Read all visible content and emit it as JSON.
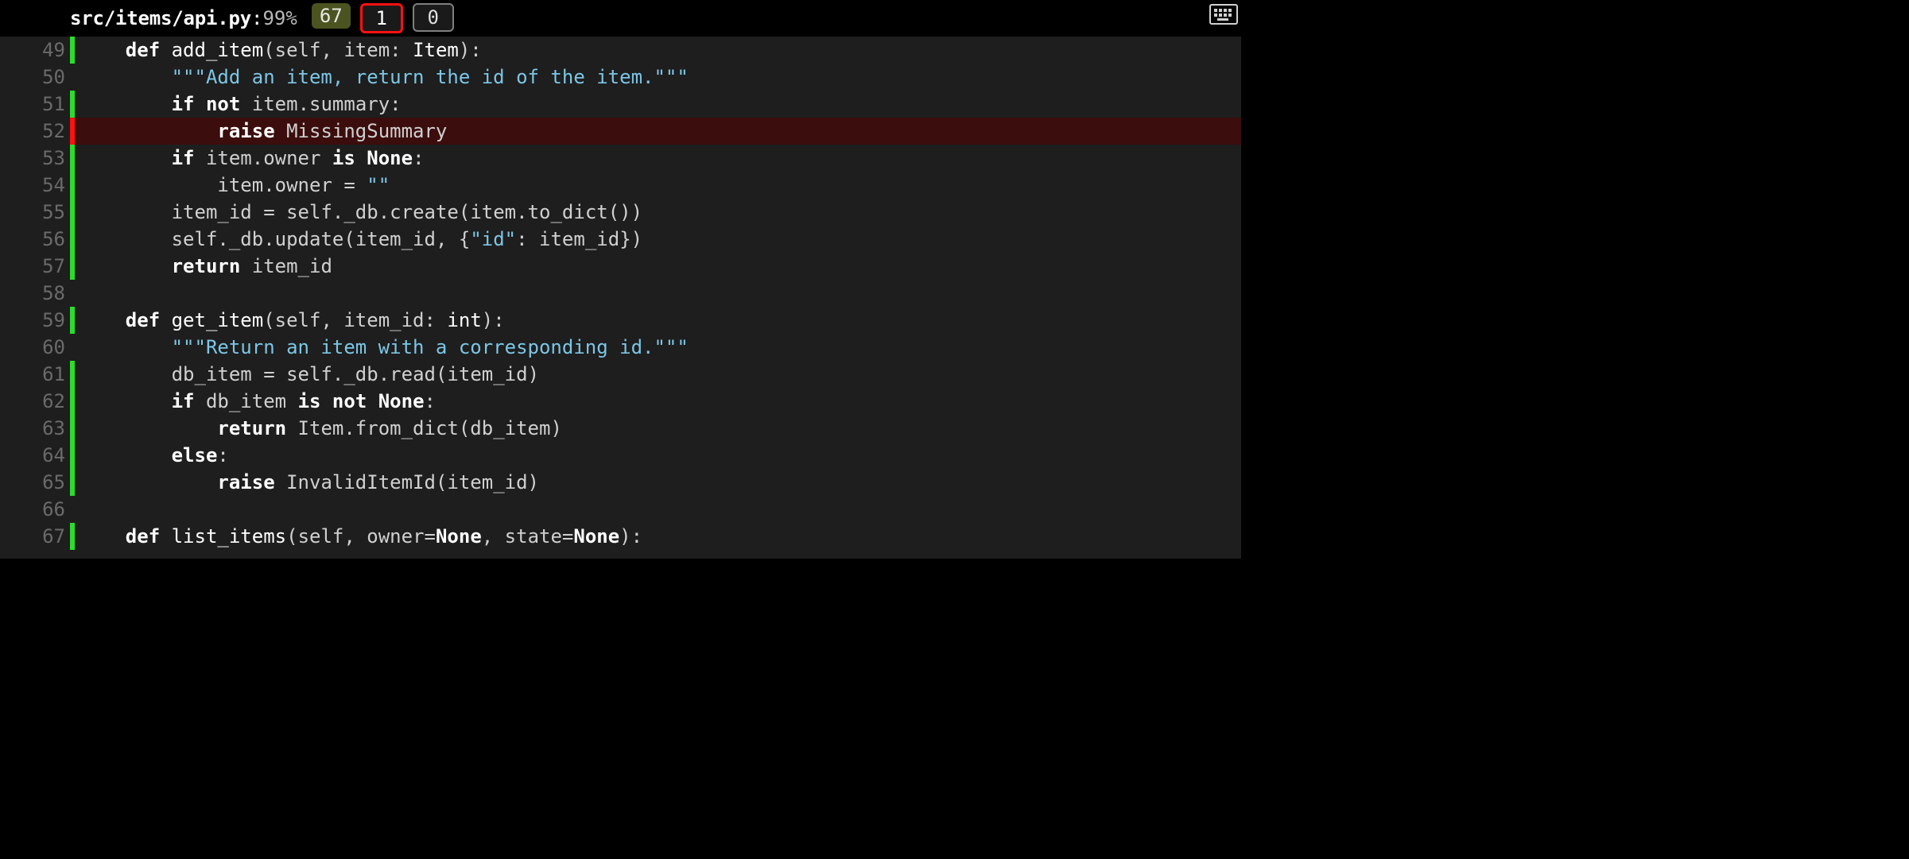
{
  "header": {
    "filepath": "src/items/api.py",
    "separator": ": ",
    "percent": "99%",
    "covered_badge": "67",
    "missing_badge": "1",
    "excluded_badge": "0"
  },
  "lines": [
    {
      "n": "49",
      "status": "run",
      "tokens": [
        {
          "t": "    ",
          "c": "id"
        },
        {
          "t": "def",
          "c": "kw"
        },
        {
          "t": " ",
          "c": "id"
        },
        {
          "t": "add_item",
          "c": "fn"
        },
        {
          "t": "(",
          "c": "op"
        },
        {
          "t": "self",
          "c": "id"
        },
        {
          "t": ", ",
          "c": "op"
        },
        {
          "t": "item",
          "c": "id"
        },
        {
          "t": ": ",
          "c": "op"
        },
        {
          "t": "Item",
          "c": "ty"
        },
        {
          "t": "):",
          "c": "op"
        }
      ]
    },
    {
      "n": "50",
      "status": "none",
      "tokens": [
        {
          "t": "        ",
          "c": "id"
        },
        {
          "t": "\"\"\"Add an item, return the id of the item.\"\"\"",
          "c": "str"
        }
      ]
    },
    {
      "n": "51",
      "status": "run",
      "tokens": [
        {
          "t": "        ",
          "c": "id"
        },
        {
          "t": "if",
          "c": "kw"
        },
        {
          "t": " ",
          "c": "id"
        },
        {
          "t": "not",
          "c": "kw"
        },
        {
          "t": " ",
          "c": "id"
        },
        {
          "t": "item",
          "c": "id"
        },
        {
          "t": ".",
          "c": "op"
        },
        {
          "t": "summary",
          "c": "id"
        },
        {
          "t": ":",
          "c": "op"
        }
      ]
    },
    {
      "n": "52",
      "status": "miss",
      "tokens": [
        {
          "t": "            ",
          "c": "id"
        },
        {
          "t": "raise",
          "c": "kw"
        },
        {
          "t": " ",
          "c": "id"
        },
        {
          "t": "MissingSummary",
          "c": "id"
        }
      ]
    },
    {
      "n": "53",
      "status": "run",
      "tokens": [
        {
          "t": "        ",
          "c": "id"
        },
        {
          "t": "if",
          "c": "kw"
        },
        {
          "t": " ",
          "c": "id"
        },
        {
          "t": "item",
          "c": "id"
        },
        {
          "t": ".",
          "c": "op"
        },
        {
          "t": "owner",
          "c": "id"
        },
        {
          "t": " ",
          "c": "id"
        },
        {
          "t": "is",
          "c": "kw"
        },
        {
          "t": " ",
          "c": "id"
        },
        {
          "t": "None",
          "c": "kw"
        },
        {
          "t": ":",
          "c": "op"
        }
      ]
    },
    {
      "n": "54",
      "status": "run",
      "tokens": [
        {
          "t": "            ",
          "c": "id"
        },
        {
          "t": "item",
          "c": "id"
        },
        {
          "t": ".",
          "c": "op"
        },
        {
          "t": "owner",
          "c": "id"
        },
        {
          "t": " = ",
          "c": "op"
        },
        {
          "t": "\"\"",
          "c": "str"
        }
      ]
    },
    {
      "n": "55",
      "status": "run",
      "tokens": [
        {
          "t": "        ",
          "c": "id"
        },
        {
          "t": "item_id",
          "c": "id"
        },
        {
          "t": " = ",
          "c": "op"
        },
        {
          "t": "self",
          "c": "id"
        },
        {
          "t": ".",
          "c": "op"
        },
        {
          "t": "_db",
          "c": "id"
        },
        {
          "t": ".",
          "c": "op"
        },
        {
          "t": "create",
          "c": "id"
        },
        {
          "t": "(",
          "c": "op"
        },
        {
          "t": "item",
          "c": "id"
        },
        {
          "t": ".",
          "c": "op"
        },
        {
          "t": "to_dict",
          "c": "id"
        },
        {
          "t": "())",
          "c": "op"
        }
      ]
    },
    {
      "n": "56",
      "status": "run",
      "tokens": [
        {
          "t": "        ",
          "c": "id"
        },
        {
          "t": "self",
          "c": "id"
        },
        {
          "t": ".",
          "c": "op"
        },
        {
          "t": "_db",
          "c": "id"
        },
        {
          "t": ".",
          "c": "op"
        },
        {
          "t": "update",
          "c": "id"
        },
        {
          "t": "(",
          "c": "op"
        },
        {
          "t": "item_id",
          "c": "id"
        },
        {
          "t": ", {",
          "c": "op"
        },
        {
          "t": "\"id\"",
          "c": "str"
        },
        {
          "t": ": ",
          "c": "op"
        },
        {
          "t": "item_id",
          "c": "id"
        },
        {
          "t": "})",
          "c": "op"
        }
      ]
    },
    {
      "n": "57",
      "status": "run",
      "tokens": [
        {
          "t": "        ",
          "c": "id"
        },
        {
          "t": "return",
          "c": "kw"
        },
        {
          "t": " ",
          "c": "id"
        },
        {
          "t": "item_id",
          "c": "id"
        }
      ]
    },
    {
      "n": "58",
      "status": "none",
      "tokens": []
    },
    {
      "n": "59",
      "status": "run",
      "tokens": [
        {
          "t": "    ",
          "c": "id"
        },
        {
          "t": "def",
          "c": "kw"
        },
        {
          "t": " ",
          "c": "id"
        },
        {
          "t": "get_item",
          "c": "fn"
        },
        {
          "t": "(",
          "c": "op"
        },
        {
          "t": "self",
          "c": "id"
        },
        {
          "t": ", ",
          "c": "op"
        },
        {
          "t": "item_id",
          "c": "id"
        },
        {
          "t": ": ",
          "c": "op"
        },
        {
          "t": "int",
          "c": "ty"
        },
        {
          "t": "):",
          "c": "op"
        }
      ]
    },
    {
      "n": "60",
      "status": "none",
      "tokens": [
        {
          "t": "        ",
          "c": "id"
        },
        {
          "t": "\"\"\"Return an item with a corresponding id.\"\"\"",
          "c": "str"
        }
      ]
    },
    {
      "n": "61",
      "status": "run",
      "tokens": [
        {
          "t": "        ",
          "c": "id"
        },
        {
          "t": "db_item",
          "c": "id"
        },
        {
          "t": " = ",
          "c": "op"
        },
        {
          "t": "self",
          "c": "id"
        },
        {
          "t": ".",
          "c": "op"
        },
        {
          "t": "_db",
          "c": "id"
        },
        {
          "t": ".",
          "c": "op"
        },
        {
          "t": "read",
          "c": "id"
        },
        {
          "t": "(",
          "c": "op"
        },
        {
          "t": "item_id",
          "c": "id"
        },
        {
          "t": ")",
          "c": "op"
        }
      ]
    },
    {
      "n": "62",
      "status": "run",
      "tokens": [
        {
          "t": "        ",
          "c": "id"
        },
        {
          "t": "if",
          "c": "kw"
        },
        {
          "t": " ",
          "c": "id"
        },
        {
          "t": "db_item",
          "c": "id"
        },
        {
          "t": " ",
          "c": "id"
        },
        {
          "t": "is",
          "c": "kw"
        },
        {
          "t": " ",
          "c": "id"
        },
        {
          "t": "not",
          "c": "kw"
        },
        {
          "t": " ",
          "c": "id"
        },
        {
          "t": "None",
          "c": "kw"
        },
        {
          "t": ":",
          "c": "op"
        }
      ]
    },
    {
      "n": "63",
      "status": "run",
      "tokens": [
        {
          "t": "            ",
          "c": "id"
        },
        {
          "t": "return",
          "c": "kw"
        },
        {
          "t": " ",
          "c": "id"
        },
        {
          "t": "Item",
          "c": "id"
        },
        {
          "t": ".",
          "c": "op"
        },
        {
          "t": "from_dict",
          "c": "id"
        },
        {
          "t": "(",
          "c": "op"
        },
        {
          "t": "db_item",
          "c": "id"
        },
        {
          "t": ")",
          "c": "op"
        }
      ]
    },
    {
      "n": "64",
      "status": "run",
      "tokens": [
        {
          "t": "        ",
          "c": "id"
        },
        {
          "t": "else",
          "c": "kw"
        },
        {
          "t": ":",
          "c": "op"
        }
      ]
    },
    {
      "n": "65",
      "status": "run",
      "tokens": [
        {
          "t": "            ",
          "c": "id"
        },
        {
          "t": "raise",
          "c": "kw"
        },
        {
          "t": " ",
          "c": "id"
        },
        {
          "t": "InvalidItemId",
          "c": "id"
        },
        {
          "t": "(",
          "c": "op"
        },
        {
          "t": "item_id",
          "c": "id"
        },
        {
          "t": ")",
          "c": "op"
        }
      ]
    },
    {
      "n": "66",
      "status": "none",
      "tokens": []
    },
    {
      "n": "67",
      "status": "run",
      "tokens": [
        {
          "t": "    ",
          "c": "id"
        },
        {
          "t": "def",
          "c": "kw"
        },
        {
          "t": " ",
          "c": "id"
        },
        {
          "t": "list_items",
          "c": "fn"
        },
        {
          "t": "(",
          "c": "op"
        },
        {
          "t": "self",
          "c": "id"
        },
        {
          "t": ", ",
          "c": "op"
        },
        {
          "t": "owner",
          "c": "id"
        },
        {
          "t": "=",
          "c": "op"
        },
        {
          "t": "None",
          "c": "kw"
        },
        {
          "t": ", ",
          "c": "op"
        },
        {
          "t": "state",
          "c": "id"
        },
        {
          "t": "=",
          "c": "op"
        },
        {
          "t": "None",
          "c": "kw"
        },
        {
          "t": "):",
          "c": "op"
        }
      ]
    }
  ]
}
